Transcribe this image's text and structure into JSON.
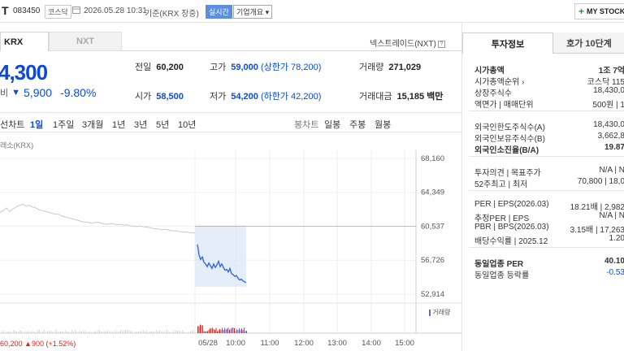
{
  "header": {
    "name_tail": "T",
    "code": "083450",
    "market": "코스닥",
    "datetime": "2026.05.28 10:31",
    "basis": "기준(KRX 장중)",
    "realtime_badge": "실시간",
    "company_info_label": "기업개요",
    "my_stock_label": "MY STOCK"
  },
  "venue_tabs": {
    "krx": "KRX",
    "nxt": "NXT"
  },
  "nextrade_link": "넥스트레이드(NXT)",
  "quote": {
    "price": "4,300",
    "change_label": "비",
    "change_value": "5,900",
    "change_pct": "-9.80%"
  },
  "stats": {
    "prev_label": "전일",
    "prev": "60,200",
    "high_label": "고가",
    "high": "59,000",
    "upper_limit": "(상한가 78,200)",
    "volume_label": "거래량",
    "volume": "271,029",
    "open_label": "시가",
    "open": "58,500",
    "low_label": "저가",
    "low": "54,200",
    "lower_limit": "(하한가 42,200)",
    "amount_label": "거래대금",
    "amount": "15,185 백만"
  },
  "periods": {
    "line_chart": "선차트",
    "items": [
      "1일",
      "1주일",
      "3개월",
      "1년",
      "3년",
      "5년",
      "10년"
    ],
    "candle_chart": "봉차트",
    "candle_items": [
      "일봉",
      "주봉",
      "월봉"
    ]
  },
  "chart_meta": {
    "source_label": "래소(KRX)",
    "volume_label": "거래량",
    "prev_close_label": "60,200",
    "change_badge": "▲900 (+1.52%)"
  },
  "chart_data": {
    "type": "line",
    "y_ticks": [
      "68,160",
      "64,349",
      "60,537",
      "56,726",
      "52,914"
    ],
    "ylim": [
      52914,
      68160
    ],
    "x_ticks": [
      "05/28",
      "10:00",
      "11:00",
      "12:00",
      "13:00",
      "14:00",
      "15:00"
    ],
    "series": [
      {
        "name": "",
        "x": [
          0,
          4,
          8,
          12,
          16,
          20,
          24,
          28,
          32,
          36,
          40,
          44,
          48,
          52,
          56,
          60,
          64,
          68,
          72,
          76,
          80,
          84,
          88,
          92,
          96,
          100,
          104,
          108,
          112,
          116,
          120,
          124,
          128,
          132,
          136,
          140,
          144,
          148,
          152,
          156,
          160,
          164,
          168,
          172,
          176,
          180,
          184,
          188,
          192,
          196,
          200,
          204,
          208,
          212,
          216,
          220,
          224,
          228,
          232,
          236,
          240
        ],
        "values": [
          62100,
          62300,
          62600,
          62200,
          62500,
          62700,
          62900,
          63000,
          62800,
          62900,
          62700,
          62600,
          62400,
          62300,
          62200,
          62100,
          62000,
          61900,
          61900,
          61700,
          61600,
          61500,
          61400,
          61300,
          61200,
          61100,
          61000,
          61000,
          60900,
          60950,
          61000,
          60900,
          60800,
          60750,
          60850,
          60800,
          60700,
          60750,
          60650,
          60700,
          60600,
          60550,
          60500,
          60550,
          60500,
          60450,
          60400,
          60300,
          60250,
          60200,
          60150,
          60200,
          60100,
          60050,
          60000,
          59950,
          59900,
          59900,
          59850,
          59800,
          59800
        ]
      },
      {
        "name": "",
        "x": [
          0,
          2,
          4,
          6,
          8,
          10,
          12,
          14,
          16,
          18,
          20,
          22,
          24,
          26,
          28,
          30,
          32,
          34,
          36,
          38,
          40,
          42,
          44,
          46,
          48,
          50,
          52,
          54,
          56,
          58,
          60
        ],
        "values": [
          58500,
          57300,
          56800,
          57100,
          56500,
          56300,
          56000,
          56400,
          56100,
          55800,
          56300,
          55900,
          56200,
          56600,
          56000,
          56300,
          55900,
          55600,
          55700,
          55400,
          55800,
          55200,
          55100,
          54900,
          55000,
          54700,
          54500,
          54600,
          54400,
          54300,
          54200
        ]
      }
    ]
  },
  "right_panel": {
    "tabs": [
      "투자정보",
      "호가 10단계"
    ],
    "rows": [
      {
        "k": "시가총액",
        "v": "1조 7억"
      },
      {
        "k": "시가총액순위 ›",
        "v": "코스닥 115"
      },
      {
        "k": "상장주식수",
        "v": "18,430,0"
      },
      {
        "k": "액면가 | 매매단위",
        "v": "500원 | 1"
      },
      {
        "k": "외국인한도주식수(A)",
        "v": "18,430,0"
      },
      {
        "k": "외국인보유주식수(B)",
        "v": "3,662,8"
      },
      {
        "k": "외국인소진율(B/A)",
        "v": "19.87"
      },
      {
        "k": "투자의견 | 목표주가",
        "v": "N/A | N"
      },
      {
        "k": "52주최고 | 최저",
        "v": "70,800 | 18,0"
      },
      {
        "k": "PER | EPS(2026.03)",
        "v": "18.21배 | 2,982"
      },
      {
        "k": "추정PER | EPS",
        "v": "N/A | N"
      },
      {
        "k": "PBR | BPS(2026.03)",
        "v": "3.15배 | 17,263"
      },
      {
        "k": "배당수익률 | 2025.12",
        "v": "1.20"
      },
      {
        "k": "동일업종 PER",
        "v": "40.10"
      },
      {
        "k": "동일업종 등락률",
        "v": "-0.53"
      }
    ]
  }
}
